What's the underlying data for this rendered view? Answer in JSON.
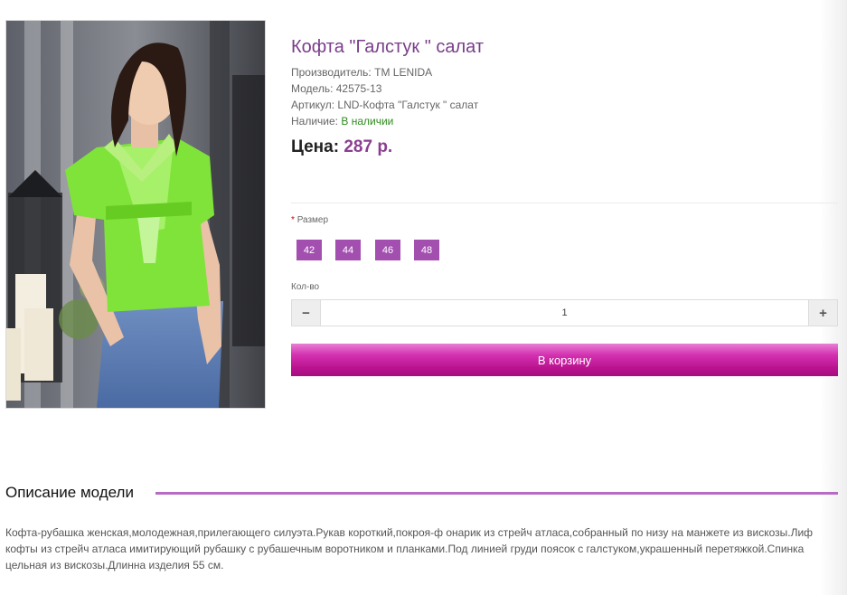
{
  "product": {
    "title": "Кофта \"Галстук \" салат",
    "manufacturer_label": "Производитель:",
    "manufacturer": "TM LENIDA",
    "model_label": "Модель:",
    "model": "42575-13",
    "article_label": "Артикул:",
    "article": "LND-Кофта \"Галстук \" салат",
    "availability_label": "Наличие:",
    "availability": "В наличии",
    "price_label": "Цена:",
    "price": "287 р."
  },
  "options": {
    "size_required_mark": "*",
    "size_label": "Размер",
    "sizes": [
      "42",
      "44",
      "46",
      "48"
    ],
    "qty_label": "Кол-во",
    "qty_minus": "−",
    "qty_value": "1",
    "qty_plus": "+",
    "cart_button": "В корзину"
  },
  "description": {
    "heading": "Описание модели",
    "text": "Кофта-рубашка женская,молодежная,прилегающего силуэта.Рукав короткий,покроя-ф онарик из стрейч атласа,собранный по низу на манжете из вискозы.Лиф кофты из стрейч атласа имитирующий рубашку с рубашечным воротником и планками.Под линией груди поясок с галстуком,украшенный перетяжкой.Спинка цельная из вискозы.Длинна изделия 55 см."
  },
  "colors": {
    "accent": "#8a3e8f",
    "size_chip": "#a34fb0",
    "cart_button": "#c0179a",
    "in_stock": "#2e8b1e",
    "heading_line": "#b86bc4"
  }
}
